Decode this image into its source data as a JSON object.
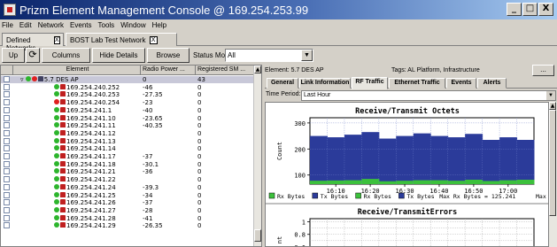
{
  "window": {
    "title": "Prizm Element Management Console @ 169.254.253.99",
    "minimize": "_",
    "maximize": "□",
    "close": "X"
  },
  "menu": [
    "File",
    "Edit",
    "Network",
    "Events",
    "Tools",
    "Window",
    "Help"
  ],
  "network_tabs": [
    {
      "label": "Defined Networks",
      "close": "X"
    },
    {
      "label": "BOST Lab Test Network",
      "close": "X"
    }
  ],
  "toolbar": {
    "up": "Up",
    "refresh_glyph": "⟳",
    "columns": "Columns",
    "hide_details": "Hide Details",
    "browse": "Browse",
    "status_mode_label": "Status Mode:",
    "status_mode_value": "All"
  },
  "table": {
    "headers": [
      "Element",
      "Radio Power ...",
      "Registered SM ..."
    ],
    "rows": [
      {
        "element": "5.7 DES AP",
        "radio_power": "0",
        "registered_sm": "43",
        "type": "ap"
      },
      {
        "element": "169.254.240.252",
        "radio_power": "-46",
        "registered_sm": "0",
        "status": "ok"
      },
      {
        "element": "169.254.240.253",
        "radio_power": "-27.35",
        "registered_sm": "0",
        "status": "ok"
      },
      {
        "element": "169.254.240.254",
        "radio_power": "-23",
        "registered_sm": "0",
        "status": "error"
      },
      {
        "element": "169.254.241.1",
        "radio_power": "-40",
        "registered_sm": "0",
        "status": "ok"
      },
      {
        "element": "169.254.241.10",
        "radio_power": "-23.65",
        "registered_sm": "0",
        "status": "ok"
      },
      {
        "element": "169.254.241.11",
        "radio_power": "-40.35",
        "registered_sm": "0",
        "status": "ok"
      },
      {
        "element": "169.254.241.12",
        "radio_power": "",
        "registered_sm": "0",
        "status": "ok"
      },
      {
        "element": "169.254.241.13",
        "radio_power": "",
        "registered_sm": "0",
        "status": "ok"
      },
      {
        "element": "169.254.241.14",
        "radio_power": "",
        "registered_sm": "0",
        "status": "ok"
      },
      {
        "element": "169.254.241.17",
        "radio_power": "-37",
        "registered_sm": "0",
        "status": "ok"
      },
      {
        "element": "169.254.241.18",
        "radio_power": "-30.1",
        "registered_sm": "0",
        "status": "ok"
      },
      {
        "element": "169.254.241.21",
        "radio_power": "-36",
        "registered_sm": "0",
        "status": "ok"
      },
      {
        "element": "169.254.241.22",
        "radio_power": "",
        "registered_sm": "0",
        "status": "ok"
      },
      {
        "element": "169.254.241.24",
        "radio_power": "-39.3",
        "registered_sm": "0",
        "status": "ok"
      },
      {
        "element": "169.254.241.25",
        "radio_power": "-34",
        "registered_sm": "0",
        "status": "ok"
      },
      {
        "element": "169.254.241.26",
        "radio_power": "-37",
        "registered_sm": "0",
        "status": "ok"
      },
      {
        "element": "169.254.241.27",
        "radio_power": "-28",
        "registered_sm": "0",
        "status": "ok"
      },
      {
        "element": "169.254.241.28",
        "radio_power": "-41",
        "registered_sm": "0",
        "status": "ok"
      },
      {
        "element": "169.254.241.29",
        "radio_power": "-26.35",
        "registered_sm": "0",
        "status": "ok"
      }
    ]
  },
  "details": {
    "element_label": "Element: 5.7 DES AP",
    "tags_label": "Tags: AL Platform, Infrastructure",
    "more_button": "...",
    "tabs": [
      "General",
      "Link Information",
      "RF Traffic",
      "Ethernet Traffic",
      "Events",
      "Alerts"
    ],
    "active_tab": "RF Traffic",
    "time_period_label": "Time Period:",
    "time_period_value": "Last Hour"
  },
  "colors": {
    "tx_bar": "#2b3b9a",
    "rx_bar": "#3cc13c",
    "status_ok": "#2db52d",
    "status_error": "#e02020"
  },
  "chart_data": [
    {
      "type": "area",
      "title": "Receive/Transmit Octets",
      "ylabel": "Count",
      "xlabel": "",
      "x": [
        "16:05",
        "16:10",
        "16:15",
        "16:20",
        "16:25",
        "16:30",
        "16:35",
        "16:40",
        "16:45",
        "16:50",
        "16:55",
        "17:00",
        "17:05"
      ],
      "x_ticks": [
        "16:10",
        "16:20",
        "16:30",
        "16:40",
        "16:50",
        "17:00"
      ],
      "y_ticks": [
        100,
        200,
        300
      ],
      "ylim": [
        65,
        320
      ],
      "series": [
        {
          "name": "Tx Bytes",
          "values": [
            250,
            245,
            255,
            265,
            240,
            250,
            260,
            250,
            245,
            258,
            235,
            245,
            235
          ]
        },
        {
          "name": "Rx Bytes",
          "values": [
            78,
            79,
            80,
            85,
            76,
            78,
            80,
            80,
            78,
            82,
            77,
            80,
            82
          ]
        }
      ],
      "legend": [
        "Rx Bytes",
        "Tx Bytes",
        "Rx Bytes",
        "Tx Bytes"
      ],
      "legend_note": "Max Rx Bytes = 125.241",
      "legend_trailing": "Max",
      "grid": true
    },
    {
      "type": "line",
      "title": "Receive/TransmitErrors",
      "ylabel": "nt",
      "y_ticks": [
        0.6,
        0.8,
        1
      ],
      "ylim": [
        0.5,
        1.05
      ],
      "grid": true,
      "series": []
    }
  ]
}
